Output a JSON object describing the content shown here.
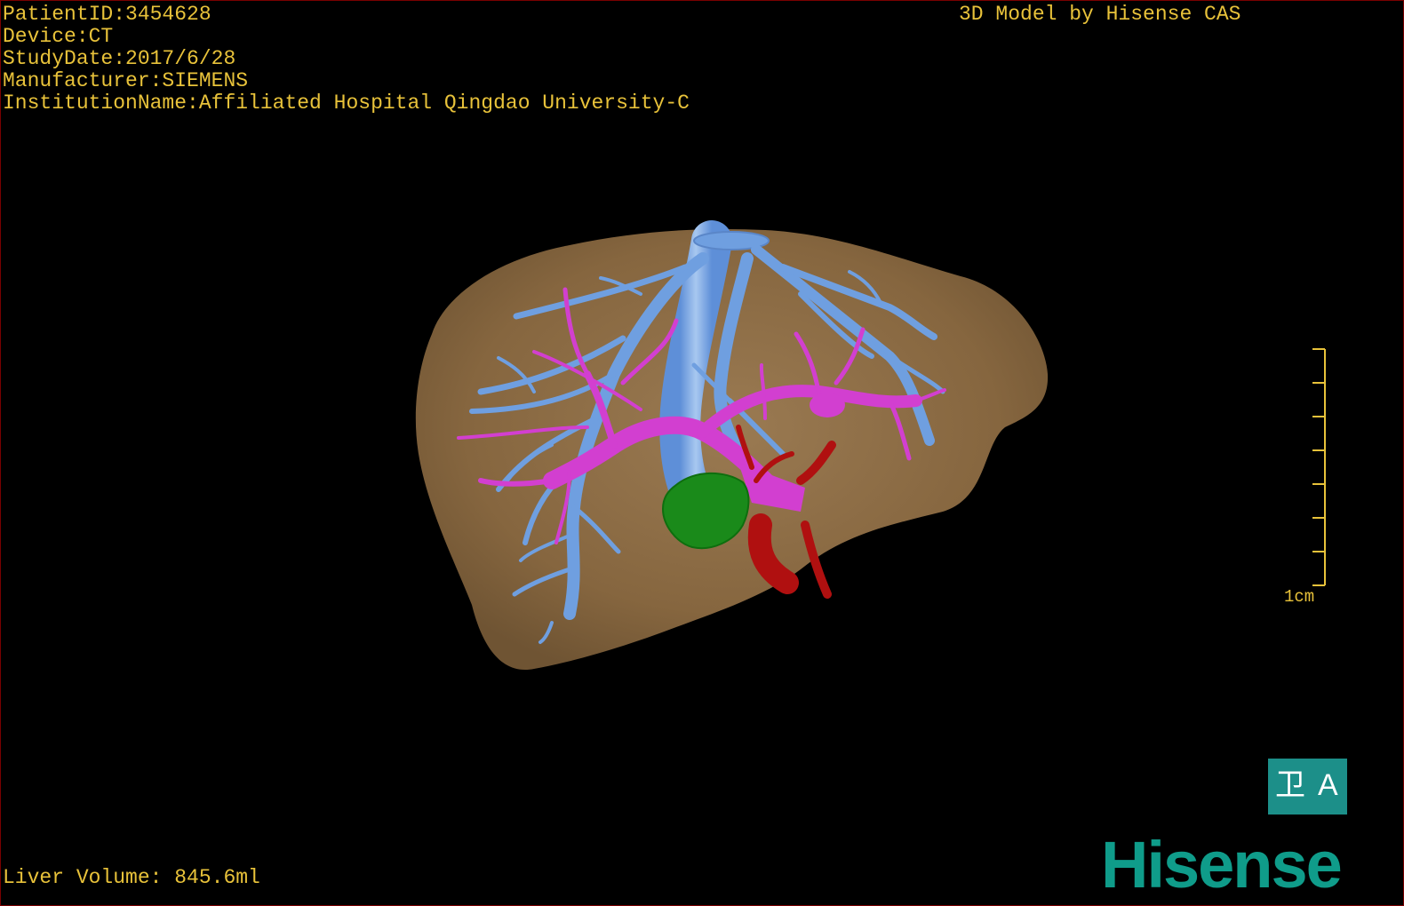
{
  "overlay": {
    "patient_id": "PatientID:3454628",
    "device": "Device:CT",
    "study_date": "StudyDate:2017/6/28",
    "manufacturer": "Manufacturer:SIEMENS",
    "institution": "InstitutionName:Affiliated Hospital Qingdao University-C",
    "model_credit": "3D Model by Hisense CAS",
    "liver_volume": "Liver Volume: 845.6ml"
  },
  "scale_bar": {
    "label": "1cm"
  },
  "badge": {
    "glyph_left": "卫",
    "glyph_right": "A"
  },
  "brand": {
    "logo_text": "Hisense"
  },
  "colors": {
    "overlay_text": "#e8c23a",
    "liver": "#8a6a45",
    "hepatic_veins": "#6f9fe0",
    "portal_vein": "#d23fd0",
    "artery": "#b01010",
    "tumor": "#1a8a1a",
    "brand": "#0f9c8a"
  }
}
